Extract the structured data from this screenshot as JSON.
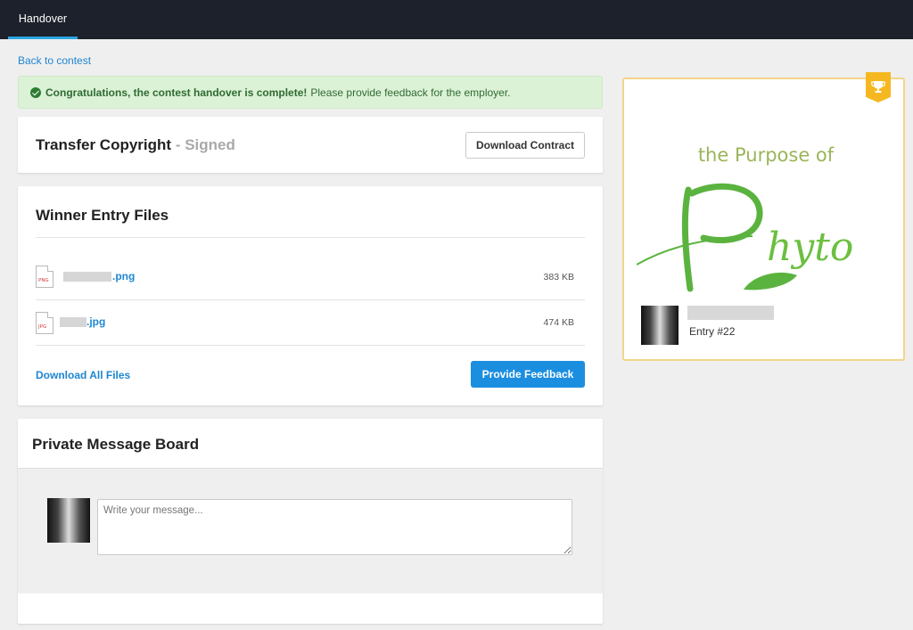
{
  "header": {
    "active_tab": "Handover"
  },
  "nav": {
    "back_link": "Back to contest"
  },
  "alert": {
    "strong_text": "Congratulations, the contest handover is complete!",
    "text": "Please provide feedback for the employer."
  },
  "copyright": {
    "title": "Transfer Copyright",
    "status": "- Signed",
    "download_button": "Download Contract"
  },
  "files": {
    "title": "Winner Entry Files",
    "items": [
      {
        "icon": "PNG",
        "name": ".png",
        "size": "383 KB"
      },
      {
        "icon": "JPG",
        "name": ".jpg",
        "size": "474 KB"
      }
    ],
    "download_all": "Download All Files",
    "feedback_button": "Provide Feedback"
  },
  "messages": {
    "title": "Private Message Board",
    "placeholder": "Write your message..."
  },
  "winner": {
    "entry_label": "Entry #22",
    "logo_tagline": "the Purpose of",
    "logo_word": "Phyto"
  },
  "colors": {
    "topbar": "#1c212b",
    "accent": "#1b8ee0",
    "success_bg": "#dcf2d6",
    "winner_border": "#f4d48a",
    "trophy": "#f5b820"
  }
}
